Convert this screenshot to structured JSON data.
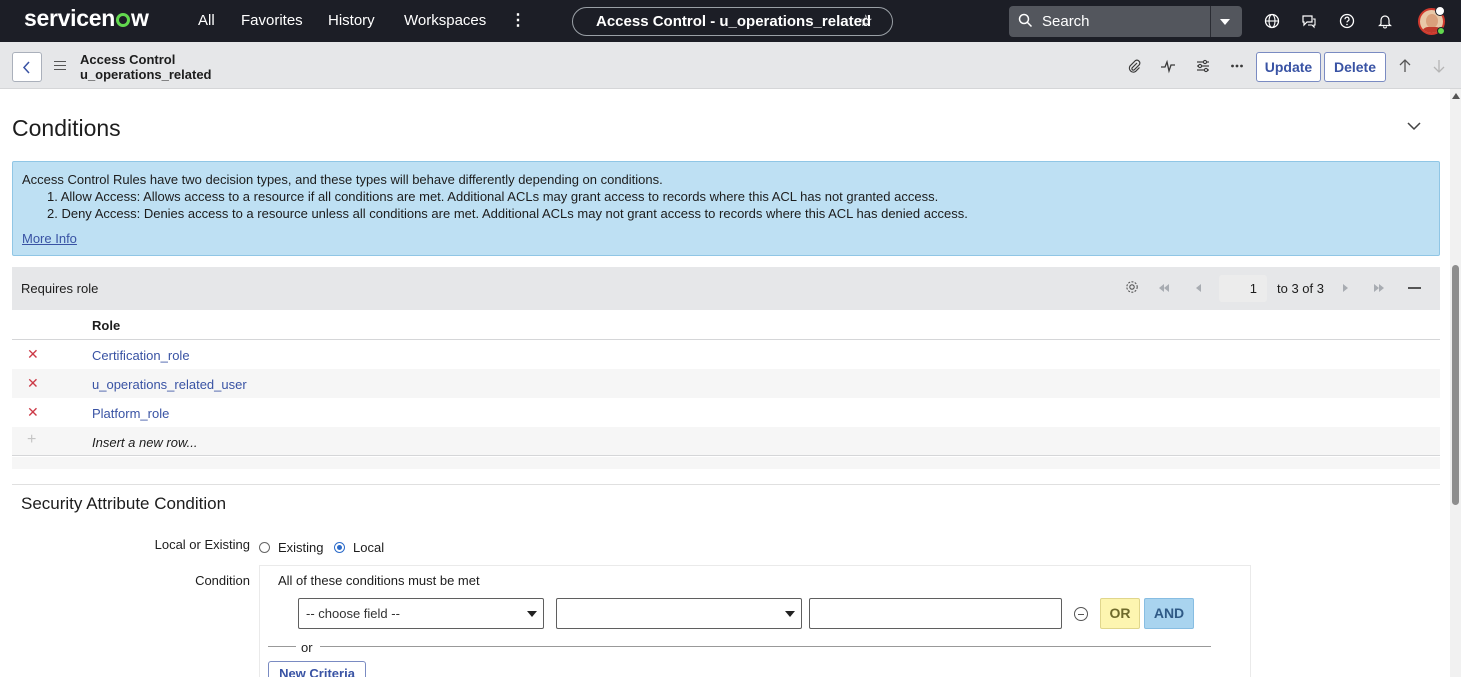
{
  "topnav": {
    "logo": "servicenow",
    "items": [
      "All",
      "Favorites",
      "History",
      "Workspaces"
    ],
    "more_icon": "vertical-ellipsis",
    "context_pill": "Access Control - u_operations_related",
    "search_placeholder": "Search",
    "icons": [
      "globe-icon",
      "chat-icon",
      "help-icon",
      "bell-icon"
    ]
  },
  "form_header": {
    "title_line1": "Access Control",
    "title_line2": "u_operations_related",
    "update_label": "Update",
    "delete_label": "Delete"
  },
  "conditions": {
    "title": "Conditions",
    "info": {
      "line1": "Access Control Rules have two decision types, and these types will behave differently depending on conditions.",
      "line2": "1. Allow Access: Allows access to a resource if all conditions are met. Additional ACLs may grant access to records where this ACL has not granted access.",
      "line3": "2. Deny Access: Denies access to a resource unless all conditions are met. Additional ACLs may not grant access to records where this ACL has denied access.",
      "more_info": "More Info"
    }
  },
  "requires_role": {
    "title": "Requires role",
    "pager_current": "1",
    "pager_text": "to 3 of 3",
    "column_header": "Role",
    "rows": [
      "Certification_role",
      "u_operations_related_user",
      "Platform_role"
    ],
    "insert_row": "Insert a new row..."
  },
  "security_attribute": {
    "title": "Security Attribute Condition",
    "local_or_existing_label": "Local or Existing",
    "radio_existing": "Existing",
    "radio_local": "Local",
    "selected": "Local",
    "condition_label": "Condition",
    "condition_note": "All of these conditions must be met",
    "field_select": "-- choose field --",
    "operator_select": "",
    "value_input": "",
    "or_button": "OR",
    "and_button": "AND",
    "or_separator": "or",
    "new_criteria": "New Criteria"
  },
  "colors": {
    "nav_bg": "#1c1e26",
    "accent": "#3953a4",
    "info_bg": "#bee0f3",
    "delete_x": "#cc3a47",
    "brand_green": "#62d84e"
  }
}
